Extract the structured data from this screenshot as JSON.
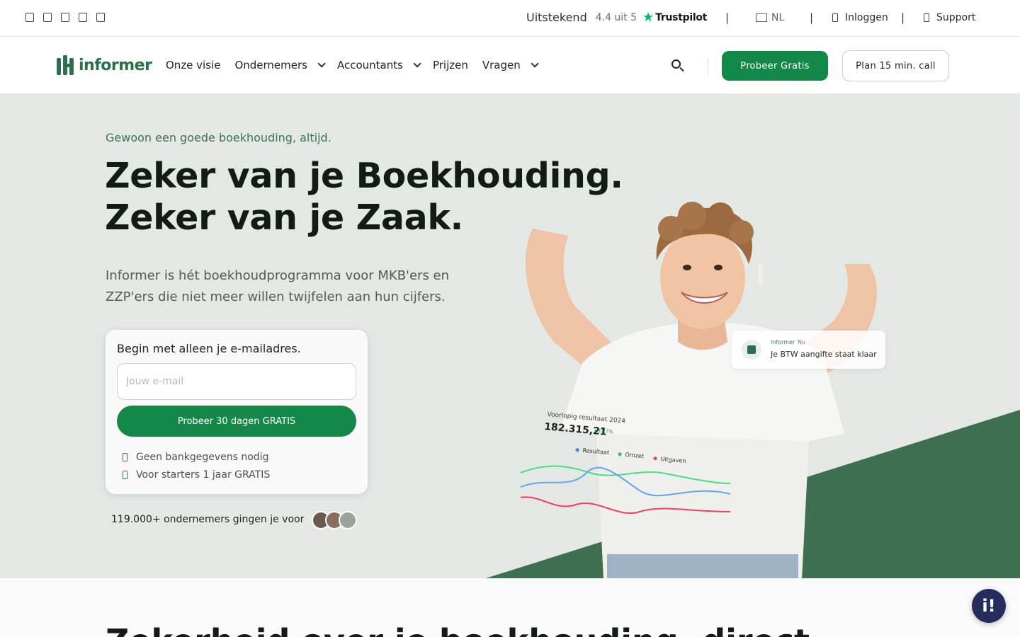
{
  "topbar": {
    "social_icons": [
      "facebook-icon",
      "instagram-icon",
      "linkedin-icon",
      "youtube-icon",
      "tiktok-icon"
    ],
    "rating_word": "Uitstekend",
    "rating_score": "4.4 uit 5",
    "trustpilot": "Trustpilot",
    "separator": "|",
    "language": "NL",
    "login": "Inloggen",
    "support": "Support"
  },
  "nav": {
    "logo_text": "informer",
    "items": [
      "Onze visie",
      "Ondernemers",
      "Accountants",
      "Prijzen",
      "Vragen"
    ],
    "try_free": "Probeer Gratis",
    "plan_call": "Plan 15 min. call"
  },
  "hero": {
    "tagline": "Gewoon een goede boekhouding, altijd.",
    "headline_line1": "Zeker van je Boekhouding.",
    "headline_line2": "Zeker van je Zaak.",
    "subtitle": "Informer is hét boekhoudprogramma voor MKB'ers en ZZP'ers die niet meer willen twijfelen aan hun cijfers.",
    "form": {
      "title": "Begin met alleen je e-mailadres.",
      "email_placeholder": "Jouw e-mail",
      "cta": "Probeer 30 dagen GRATIS",
      "check1": "Geen bankgegevens nodig",
      "check2": "Voor starters 1 jaar GRATIS"
    },
    "social_proof": "119.000+ ondernemers gingen je voor",
    "notification": {
      "app": "Informer",
      "time": "Nu",
      "message": "Je BTW aangifte staat klaar"
    },
    "result_card": {
      "title": "Voorlopig resultaat 2024",
      "value": "182.315,21",
      "change": "+31,7%",
      "legend": [
        "Resultaat",
        "Omzet",
        "Uitgaven"
      ]
    }
  },
  "colors": {
    "brand_green": "#148848",
    "dark_green": "#3f6f51",
    "hero_bg": "#e3e8e4",
    "chat_bubble": "#262d5a"
  },
  "section2": {
    "title": "Zekerheid over je boekhouding, direct"
  },
  "chat_label": "i!"
}
